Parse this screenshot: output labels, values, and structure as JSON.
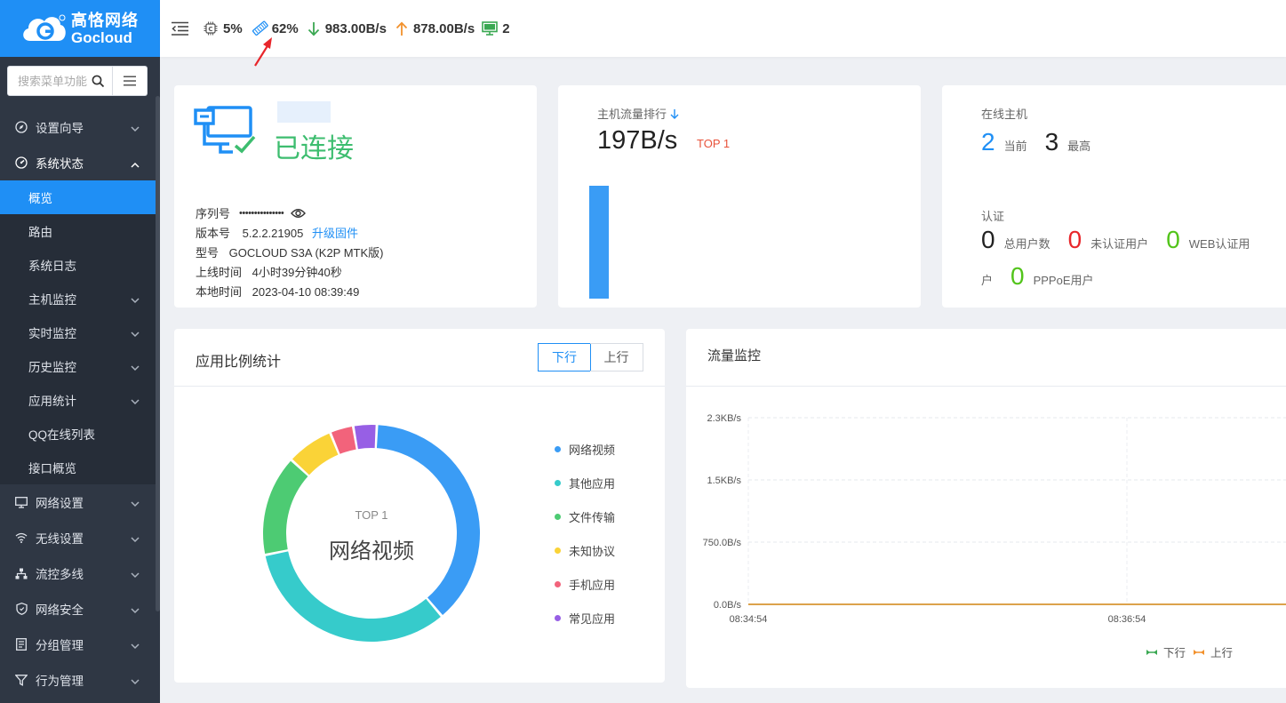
{
  "brand": {
    "name_cn": "高恪网络",
    "name_en": "Gocloud"
  },
  "search": {
    "placeholder": "搜索菜单功能"
  },
  "sidebar": {
    "items": [
      {
        "label": "设置向导",
        "icon": "compass-icon"
      },
      {
        "label": "系统状态",
        "icon": "dashboard-icon",
        "expanded": true
      }
    ],
    "sub_items": [
      {
        "label": "概览",
        "active": true
      },
      {
        "label": "路由"
      },
      {
        "label": "系统日志"
      },
      {
        "label": "主机监控",
        "expandable": true
      },
      {
        "label": "实时监控",
        "expandable": true
      },
      {
        "label": "历史监控",
        "expandable": true
      },
      {
        "label": "应用统计",
        "expandable": true
      },
      {
        "label": "QQ在线列表"
      },
      {
        "label": "接口概览"
      }
    ],
    "bottom_items": [
      {
        "label": "网络设置",
        "icon": "monitor-icon"
      },
      {
        "label": "无线设置",
        "icon": "wifi-icon"
      },
      {
        "label": "流控多线",
        "icon": "network-icon"
      },
      {
        "label": "网络安全",
        "icon": "shield-icon"
      },
      {
        "label": "分组管理",
        "icon": "group-icon"
      },
      {
        "label": "行为管理",
        "icon": "filter-icon"
      }
    ]
  },
  "topbar": {
    "cpu": "5%",
    "memory": "62%",
    "download": "983.00B/s",
    "upload": "878.00B/s",
    "hosts": "2"
  },
  "status": {
    "connection": "已连接",
    "serial_label": "序列号",
    "serial_value": "•••••••••••••••",
    "version_label": "版本号",
    "version_value": "5.2.2.21905",
    "upgrade_link": "升级固件",
    "model_label": "型号",
    "model_value": "GOCLOUD S3A (K2P MTK版)",
    "uptime_label": "上线时间",
    "uptime_value": "4小时39分钟40秒",
    "localtime_label": "本地时间",
    "localtime_value": "2023-04-10 08:39:49"
  },
  "traffic_rank": {
    "title": "主机流量排行",
    "value": "197B/s",
    "badge": "TOP 1",
    "bar_level": 1.0
  },
  "online": {
    "title": "在线主机",
    "current_value": "2",
    "current_label": "当前",
    "max_value": "3",
    "max_label": "最高",
    "auth_title": "认证",
    "total_value": "0",
    "total_label": "总用户数",
    "unauth_value": "0",
    "unauth_label": "未认证用户",
    "web_value": "0",
    "web_label": "WEB认证用",
    "web_label_cont": "户",
    "pppoe_value": "0",
    "pppoe_label": "PPPoE用户"
  },
  "app_stats": {
    "title": "应用比例统计",
    "tabs": [
      "下行",
      "上行"
    ],
    "active_tab": "下行",
    "center_top": "TOP 1",
    "center_label": "网络视频",
    "chart_data": {
      "type": "pie",
      "categories": [
        "网络视频",
        "其他应用",
        "文件传输",
        "未知协议",
        "手机应用",
        "常见应用"
      ],
      "values": [
        38,
        33,
        15,
        7,
        3.5,
        3.5
      ],
      "colors": [
        "#3a9cf5",
        "#36cbcb",
        "#4dcb73",
        "#fad337",
        "#f2637b",
        "#975fe5"
      ]
    }
  },
  "traffic_monitor": {
    "title": "流量监控",
    "legend_down": "下行",
    "legend_up": "上行",
    "chart_data": {
      "type": "line",
      "x": [
        "08:34:54",
        "08:36:54"
      ],
      "yticks": [
        "0.0B/s",
        "750.0B/s",
        "1.5KB/s",
        "2.3KB/s"
      ],
      "series": [
        {
          "name": "下行",
          "color": "#3aa852",
          "values": [
            0,
            0
          ]
        },
        {
          "name": "上行",
          "color": "#f2912c",
          "values": [
            0,
            0
          ]
        }
      ]
    }
  }
}
